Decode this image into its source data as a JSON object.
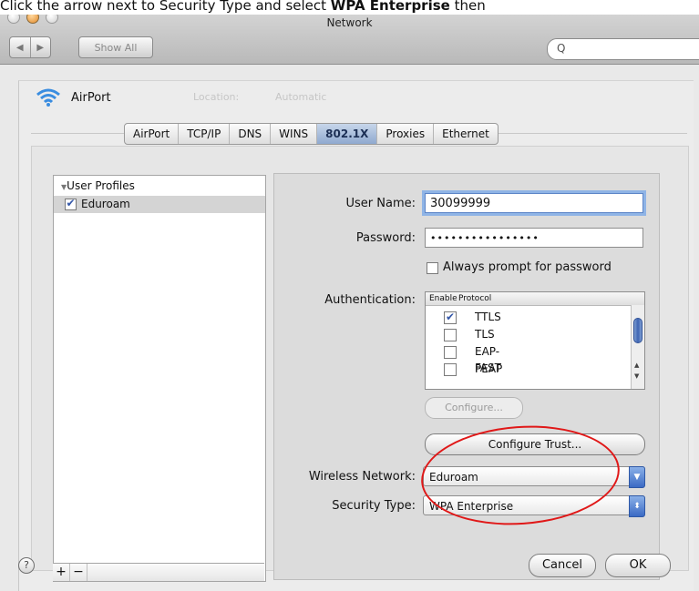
{
  "instruction": {
    "prefix": "Click the arrow next to Security Type and select ",
    "bold": "WPA Enterprise",
    "suffix": " then"
  },
  "window": {
    "title": "Network",
    "show_all": "Show All",
    "search_icon": "Q",
    "back_icon": "◀",
    "forward_icon": "▶"
  },
  "interface": {
    "name": "AirPort",
    "ghost_location": "Location:",
    "ghost_automatic": "Automatic"
  },
  "tabs": [
    {
      "label": "AirPort"
    },
    {
      "label": "TCP/IP"
    },
    {
      "label": "DNS"
    },
    {
      "label": "WINS"
    },
    {
      "label": "802.1X",
      "active": true
    },
    {
      "label": "Proxies"
    },
    {
      "label": "Ethernet"
    }
  ],
  "profiles": {
    "header": "User Profiles",
    "items": [
      {
        "label": "Eduroam",
        "checked": true
      }
    ],
    "add": "+",
    "remove": "−"
  },
  "form": {
    "username_label": "User Name:",
    "username_value": "30099999",
    "password_label": "Password:",
    "password_value": "••••••••••••••••",
    "always_prompt": "Always prompt for password",
    "auth_label": "Authentication:",
    "auth_header_enable": "Enable",
    "auth_header_protocol": "Protocol",
    "protocols": [
      {
        "name": "TTLS",
        "checked": true
      },
      {
        "name": "TLS",
        "checked": false
      },
      {
        "name": "EAP-FAST",
        "checked": false
      },
      {
        "name": "PEAP",
        "checked": false
      }
    ],
    "configure": "Configure...",
    "configure_trust": "Configure Trust...",
    "wireless_label": "Wireless Network:",
    "wireless_value": "Eduroam",
    "security_label": "Security Type:",
    "security_value": "WPA Enterprise"
  },
  "footer": {
    "help": "?",
    "cancel": "Cancel",
    "ok": "OK"
  },
  "colors": {
    "highlight_ring": "#e01818",
    "accent": "#3b6ac4"
  }
}
